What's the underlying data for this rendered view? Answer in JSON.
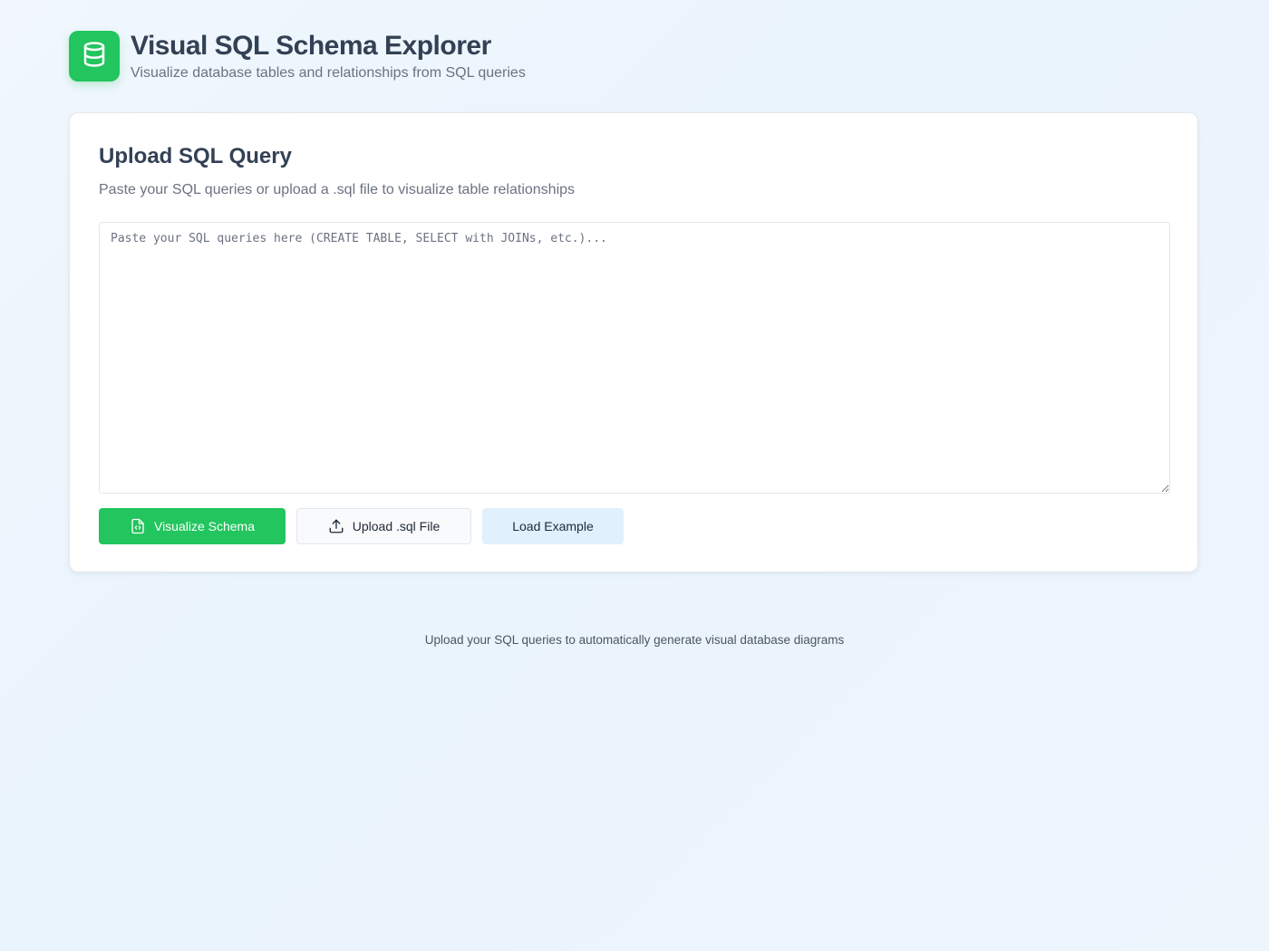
{
  "header": {
    "logo_icon": "database-icon",
    "title": "Visual SQL Schema Explorer",
    "subtitle": "Visualize database tables and relationships from SQL queries"
  },
  "upload_card": {
    "title": "Upload SQL Query",
    "description": "Paste your SQL queries or upload a .sql file to visualize table relationships",
    "sql_input": {
      "value": "",
      "placeholder": "Paste your SQL queries here (CREATE TABLE, SELECT with JOINs, etc.)..."
    },
    "buttons": {
      "visualize": {
        "label": "Visualize Schema",
        "icon": "file-code-icon"
      },
      "upload": {
        "label": "Upload .sql File",
        "icon": "upload-icon"
      },
      "example": {
        "label": "Load Example"
      }
    }
  },
  "footer": {
    "note": "Upload your SQL queries to automatically generate visual database diagrams"
  },
  "colors": {
    "accent": "#22c55e",
    "background": "#eef6fd",
    "soft_button": "#e0f0fd"
  }
}
